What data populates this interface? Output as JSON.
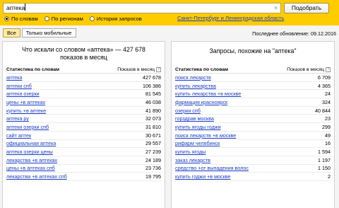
{
  "search": {
    "query": "аптека",
    "button": "Подобрать",
    "clear_glyph": "×"
  },
  "modes": [
    {
      "label": "По словам",
      "selected": true
    },
    {
      "label": "По регионам",
      "selected": false
    },
    {
      "label": "История запросов",
      "selected": false
    }
  ],
  "region": "Санкт-Петербург и Ленинградская область",
  "filters": [
    {
      "label": "Все",
      "active": true
    },
    {
      "label": "Только мобильные",
      "active": false
    }
  ],
  "last_updated": "Последнее обновление: 09.12.2016",
  "left": {
    "title_line1": "Что искали со словом «аптека» — 427 678",
    "title_line2": "показов в месяц",
    "col_keyword": "Статистика по словам",
    "col_count": "Показов в месяц",
    "rows": [
      {
        "kw": "аптека",
        "cnt": "427 678"
      },
      {
        "kw": "аптеки спб",
        "cnt": "106 386"
      },
      {
        "kw": "аптека озерки",
        "cnt": "81 545"
      },
      {
        "kw": "цены +в аптеках",
        "cnt": "46 038"
      },
      {
        "kw": "купить +в аптеке",
        "cnt": "41 890"
      },
      {
        "kw": "аптека ру",
        "cnt": "32 073"
      },
      {
        "kw": "аптеки озерки спб",
        "cnt": "31 810"
      },
      {
        "kw": "сайт аптек",
        "cnt": "30 671"
      },
      {
        "kw": "официальная аптека",
        "cnt": "29 557"
      },
      {
        "kw": "аптека озерки цены",
        "cnt": "27 239"
      },
      {
        "kw": "лекарства +в аптеках",
        "cnt": "24 189"
      },
      {
        "kw": "цены +в аптеках спб",
        "cnt": "23 736"
      },
      {
        "kw": "лекарства +в аптеках спб",
        "cnt": "19 795"
      }
    ]
  },
  "right": {
    "title": "Запросы, похожие на \"аптека\"",
    "col_keyword": "Статистика по словам",
    "col_count": "Показов в месяц",
    "rows": [
      {
        "kw": "поиск лекарств",
        "cnt": "6 709"
      },
      {
        "kw": "купить лекарства",
        "cnt": "4 365"
      },
      {
        "kw": "купить лекарства +в москве",
        "cnt": "24"
      },
      {
        "kw": "фармация красноярск",
        "cnt": "324"
      },
      {
        "kw": "озерки спб",
        "cnt": "40 844"
      },
      {
        "kw": "горздрав москва",
        "cnt": "23"
      },
      {
        "kw": "купить ягоды годжи",
        "cnt": "299"
      },
      {
        "kw": "поиск лекарств +в москве",
        "cnt": "49"
      },
      {
        "kw": "рифарм челябинск",
        "cnt": "16"
      },
      {
        "kw": "купить ягоды",
        "cnt": "1 594"
      },
      {
        "kw": "заказ лекарств",
        "cnt": "1 197"
      },
      {
        "kw": "средство +от выпадения волос",
        "cnt": "1 150"
      },
      {
        "kw": "купить годжи +в москве",
        "cnt": "2"
      }
    ]
  },
  "colors": {
    "accent": "#ffcc00",
    "link": "#1a3dc1"
  }
}
